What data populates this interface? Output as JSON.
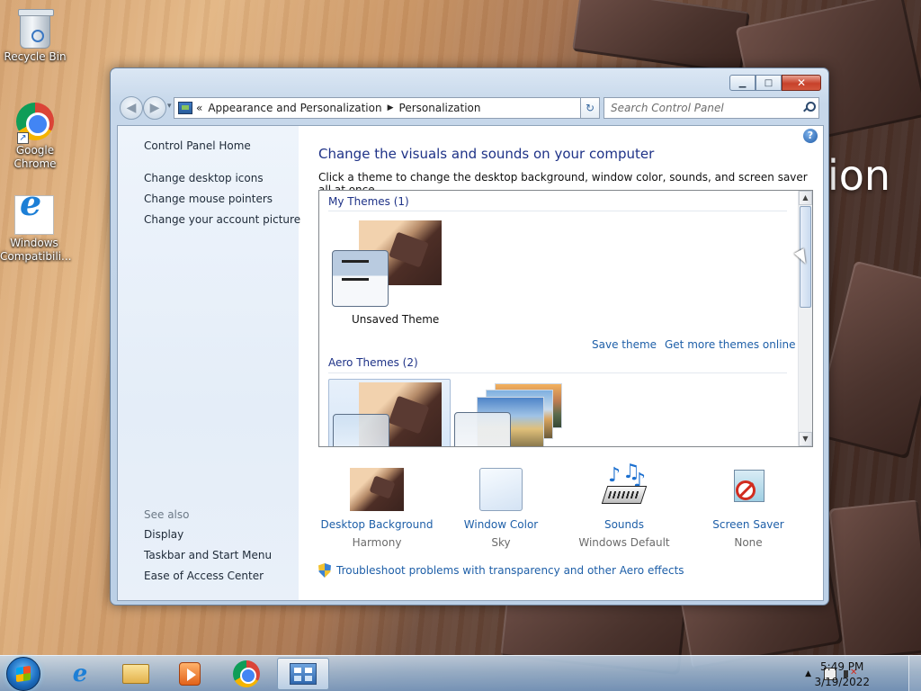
{
  "desktop": {
    "wallpaper_text": "ion",
    "icons": [
      {
        "label": "Recycle Bin",
        "icon": "recycle-bin-icon"
      },
      {
        "label": "Google Chrome",
        "icon": "chrome-icon"
      },
      {
        "label": "Windows Compatibili...",
        "icon": "internet-explorer-icon"
      }
    ]
  },
  "window": {
    "controls": {
      "minimize": "▁",
      "maximize": "□",
      "close": "✕"
    },
    "nav": {
      "back": "◀",
      "forward": "▶",
      "dropdown": "▾"
    },
    "address": {
      "prefix": "«",
      "crumbs": [
        "Appearance and Personalization",
        "Personalization"
      ],
      "separator": "▶",
      "dropdown": "▾"
    },
    "refresh": "↻",
    "search": {
      "placeholder": "Search Control Panel"
    },
    "sidebar": {
      "home": "Control Panel Home",
      "links": [
        "Change desktop icons",
        "Change mouse pointers",
        "Change your account picture"
      ],
      "see_also_title": "See also",
      "see_also": [
        "Display",
        "Taskbar and Start Menu",
        "Ease of Access Center"
      ]
    },
    "main": {
      "help": "?",
      "title": "Change the visuals and sounds on your computer",
      "subtitle": "Click a theme to change the desktop background, window color, sounds, and screen saver all at once.",
      "my_themes": {
        "title": "My Themes (1)",
        "items": [
          {
            "label": "Unsaved Theme"
          }
        ]
      },
      "save_theme": "Save theme",
      "get_more": "Get more themes online",
      "aero_themes": {
        "title": "Aero Themes (2)"
      },
      "scroll": {
        "up": "▲",
        "down": "▼"
      },
      "tiles": [
        {
          "label": "Desktop Background",
          "value": "Harmony"
        },
        {
          "label": "Window Color",
          "value": "Sky"
        },
        {
          "label": "Sounds",
          "value": "Windows Default"
        },
        {
          "label": "Screen Saver",
          "value": "None"
        }
      ],
      "troubleshoot": "Troubleshoot problems with transparency and other Aero effects"
    }
  },
  "taskbar": {
    "tray_up": "▲",
    "time": "5:49 PM",
    "date": "3/19/2022"
  },
  "colors": {
    "link": "#1e5fa8",
    "heading": "#1e3287",
    "accent": "#3a77c2"
  }
}
